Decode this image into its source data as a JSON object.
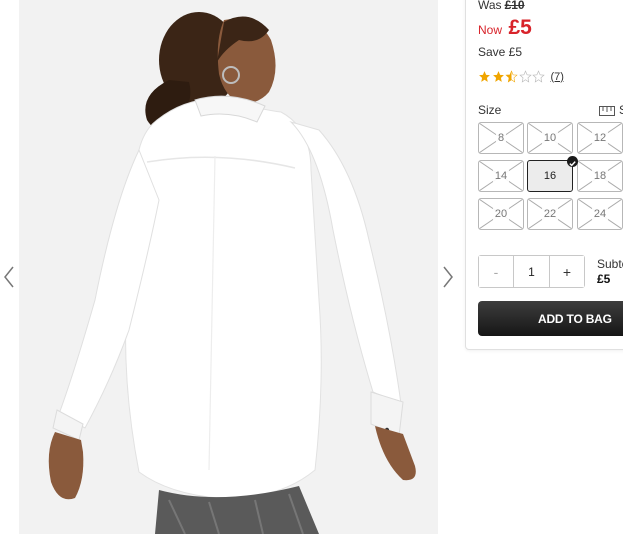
{
  "gallery": {
    "image_alt_icon": "product-photo",
    "prev_icon": "chevron-left-icon",
    "next_icon": "chevron-right-icon"
  },
  "pricing": {
    "was_label": "Was",
    "was_price": "£10",
    "now_label": "Now",
    "now_price": "£5",
    "save_text": "Save £5",
    "accent_color": "#d8232a"
  },
  "rating": {
    "stars": 2.5,
    "max_stars": 5,
    "review_count": "(7)",
    "star_color": "#f0a500"
  },
  "size": {
    "label": "Size",
    "guide_icon": "ruler-icon",
    "guide_text": "S",
    "options": [
      {
        "label": "8",
        "available": false
      },
      {
        "label": "10",
        "available": false
      },
      {
        "label": "12",
        "available": false
      },
      {
        "label": "14",
        "available": false
      },
      {
        "label": "16",
        "available": true,
        "selected": true
      },
      {
        "label": "18",
        "available": false
      },
      {
        "label": "20",
        "available": false
      },
      {
        "label": "22",
        "available": false
      },
      {
        "label": "24",
        "available": false
      }
    ]
  },
  "quantity": {
    "minus_label": "-",
    "value": "1",
    "plus_label": "+"
  },
  "subtotal": {
    "label": "Subto",
    "value": "£5"
  },
  "cta": {
    "add_to_bag_label": "ADD TO BAG"
  }
}
